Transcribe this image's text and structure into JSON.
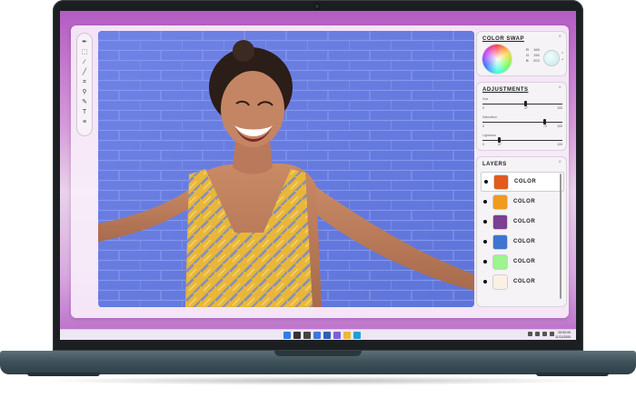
{
  "app": {
    "panels": {
      "color_swap": {
        "title": "COLOR SWAP",
        "close": "×",
        "values": [
          {
            "k": "R",
            "v": "168"
          },
          {
            "k": "G",
            "v": "156"
          },
          {
            "k": "B",
            "v": "203"
          }
        ],
        "swatch_color": "#bfe9e8"
      },
      "adjustments": {
        "title": "ADJUSTMENTS",
        "close": "×",
        "sliders": [
          {
            "label": "Hue",
            "min": "0",
            "current": "37",
            "max": "100",
            "fraction": 0.55
          },
          {
            "label": "Saturation",
            "min": "0",
            "current": "72",
            "max": "100",
            "fraction": 0.78
          },
          {
            "label": "Lightness",
            "min": "0",
            "current": "37",
            "max": "100",
            "fraction": 0.22
          }
        ]
      },
      "layers": {
        "title": "LAYERS",
        "close": "×",
        "items": [
          {
            "name": "COLOR",
            "color": "#e25a1c",
            "selected": true
          },
          {
            "name": "COLOR",
            "color": "#f09a1e",
            "selected": false
          },
          {
            "name": "COLOR",
            "color": "#7b3f93",
            "selected": false
          },
          {
            "name": "COLOR",
            "color": "#3e74d2",
            "selected": false
          },
          {
            "name": "COLOR",
            "color": "#9cf58e",
            "selected": false
          },
          {
            "name": "COLOR",
            "color": "#fbf1e3",
            "selected": false
          }
        ]
      }
    },
    "tools": [
      {
        "name": "eyedropper-tool-icon",
        "glyph": "✒"
      },
      {
        "name": "crop-tool-icon",
        "glyph": "⬚"
      },
      {
        "name": "brush-tool-icon",
        "glyph": "∕"
      },
      {
        "name": "pen-tool-icon",
        "glyph": "╱"
      },
      {
        "name": "transform-tool-icon",
        "glyph": "⌗"
      },
      {
        "name": "zoom-tool-icon",
        "glyph": "⚲"
      },
      {
        "name": "marker-tool-icon",
        "glyph": "✎"
      },
      {
        "name": "text-tool-icon",
        "glyph": "T"
      },
      {
        "name": "more-tools-icon",
        "glyph": "≡"
      }
    ]
  },
  "taskbar": {
    "apps": [
      {
        "name": "start-icon",
        "color": "#2f7ee6"
      },
      {
        "name": "search-icon",
        "color": "#333333"
      },
      {
        "name": "task-view-icon",
        "color": "#444444"
      },
      {
        "name": "widgets-icon",
        "color": "#3a79d6"
      },
      {
        "name": "store-icon",
        "color": "#2b5fb8"
      },
      {
        "name": "chat-icon",
        "color": "#7b61d6"
      },
      {
        "name": "file-explorer-icon",
        "color": "#e8b93a"
      },
      {
        "name": "edge-icon",
        "color": "#1f9fd6"
      }
    ],
    "clock": {
      "time": "00:00:00",
      "date": "11/11/2000"
    }
  }
}
